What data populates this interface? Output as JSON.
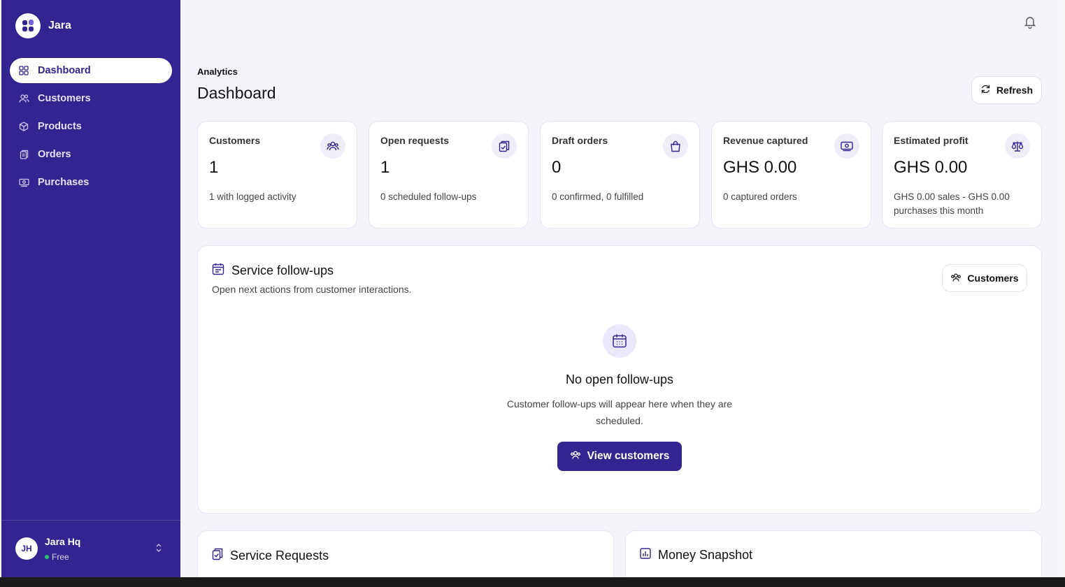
{
  "app": {
    "brand_name": "Jara"
  },
  "sidebar": {
    "items": [
      {
        "label": "Dashboard",
        "icon": "grid-icon",
        "active": true
      },
      {
        "label": "Customers",
        "icon": "users-icon",
        "active": false
      },
      {
        "label": "Products",
        "icon": "box-icon",
        "active": false
      },
      {
        "label": "Orders",
        "icon": "clipboard-icon",
        "active": false
      },
      {
        "label": "Purchases",
        "icon": "cash-icon",
        "active": false
      }
    ],
    "user": {
      "initials": "JH",
      "name": "Jara Hq",
      "plan": "Free"
    }
  },
  "header": {
    "eyebrow": "Analytics",
    "title": "Dashboard",
    "refresh_label": "Refresh"
  },
  "stats": [
    {
      "label": "Customers",
      "value": "1",
      "sub": "1 with logged activity",
      "icon": "users-icon"
    },
    {
      "label": "Open requests",
      "value": "1",
      "sub": "0 scheduled follow-ups",
      "icon": "clipboard-check-icon"
    },
    {
      "label": "Draft orders",
      "value": "0",
      "sub": "0 confirmed, 0 fulfilled",
      "icon": "shopping-bag-icon"
    },
    {
      "label": "Revenue captured",
      "value": "GHS 0.00",
      "sub": "0 captured orders",
      "icon": "cash-icon"
    },
    {
      "label": "Estimated profit",
      "value": "GHS 0.00",
      "sub": "GHS 0.00 sales - GHS 0.00 purchases this month",
      "icon": "scale-icon"
    }
  ],
  "followups": {
    "title": "Service follow-ups",
    "description": "Open next actions from customer interactions.",
    "button_label": "Customers",
    "empty_title": "No open follow-ups",
    "empty_description": "Customer follow-ups will appear here when they are scheduled.",
    "cta_label": "View customers"
  },
  "service_requests": {
    "title": "Service Requests"
  },
  "money_snapshot": {
    "title": "Money Snapshot"
  },
  "colors": {
    "brand": "#32258f",
    "background": "#f5f4fb",
    "success": "#2fbf71"
  }
}
